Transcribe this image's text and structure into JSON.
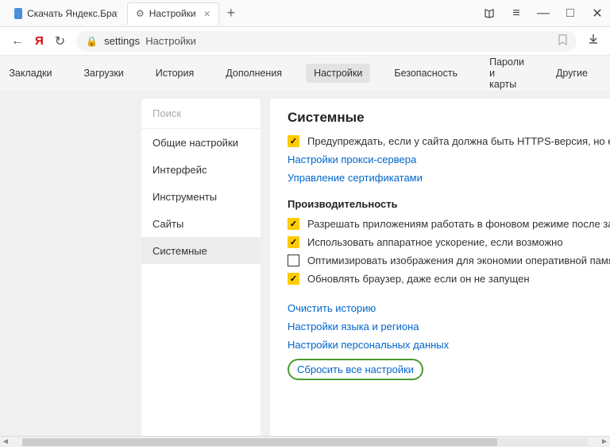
{
  "tabs": [
    {
      "label": "Скачать Яндекс.Браузер д..."
    },
    {
      "label": "Настройки"
    }
  ],
  "address": {
    "path": "settings",
    "title": "Настройки"
  },
  "nav": {
    "items": [
      "Закладки",
      "Загрузки",
      "История",
      "Дополнения",
      "Настройки",
      "Безопасность",
      "Пароли и карты",
      "Другие"
    ],
    "active": "Настройки"
  },
  "sidebar": {
    "search_placeholder": "Поиск",
    "items": [
      "Общие настройки",
      "Интерфейс",
      "Инструменты",
      "Сайты",
      "Системные"
    ],
    "active": "Системные"
  },
  "main": {
    "title": "Системные",
    "https_warn": "Предупреждать, если у сайта должна быть HTTPS-версия, но её нет",
    "proxy_link": "Настройки прокси-сервера",
    "cert_link": "Управление сертификатами",
    "perf_title": "Производительность",
    "bg_apps": "Разрешать приложениям работать в фоновом режиме после закрытия бр",
    "hw_accel": "Использовать аппаратное ускорение, если возможно",
    "optimize_img": "Оптимизировать изображения для экономии оперативной памяти",
    "update_bg": "Обновлять браузер, даже если он не запущен",
    "clear_history": "Очистить историю",
    "lang_region": "Настройки языка и региона",
    "personal_data": "Настройки персональных данных",
    "reset_all": "Сбросить все настройки"
  }
}
